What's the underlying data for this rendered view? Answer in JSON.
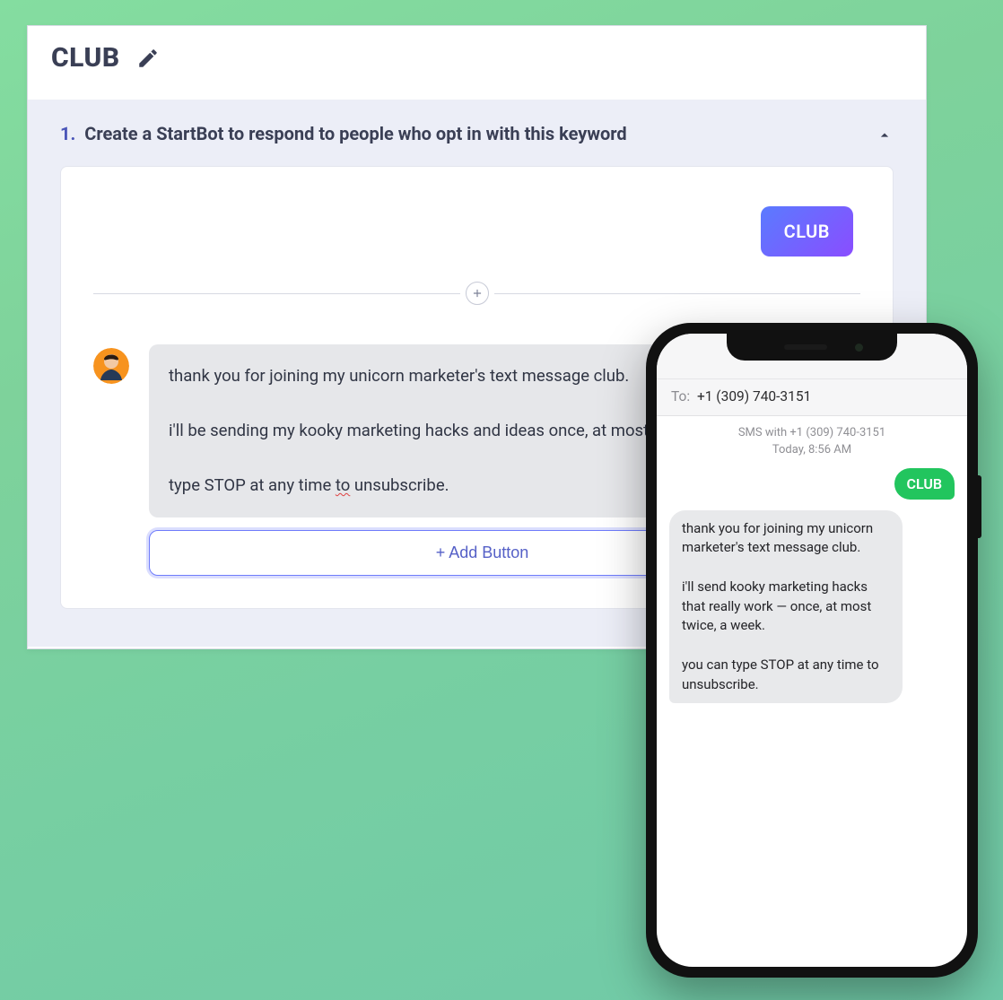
{
  "header": {
    "title": "CLUB"
  },
  "step": {
    "number": "1.",
    "title": "Create a StartBot to respond to people who opt in with this keyword"
  },
  "keyword": "CLUB",
  "message": {
    "text_part1": "thank you for joining my unicorn marketer's text message club.\n\ni'll be sending my kooky marketing hacks and ideas once, at most twice, a week.\n\ntype STOP at any time ",
    "text_spell": "to",
    "text_part2": " unsubscribe."
  },
  "add_button_label": "+ Add Button",
  "phone": {
    "to_label": "To:",
    "to_number": "+1 (309) 740-3151",
    "meta_line1": "SMS with +1 (309) 740-3151",
    "meta_line2": "Today, 8:56 AM",
    "outgoing": "CLUB",
    "incoming": "thank you for joining my unicorn marketer's text message club.\n\ni'll send kooky marketing hacks that really work — once, at most twice, a week.\n\nyou can type STOP at any time to unsubscribe."
  }
}
